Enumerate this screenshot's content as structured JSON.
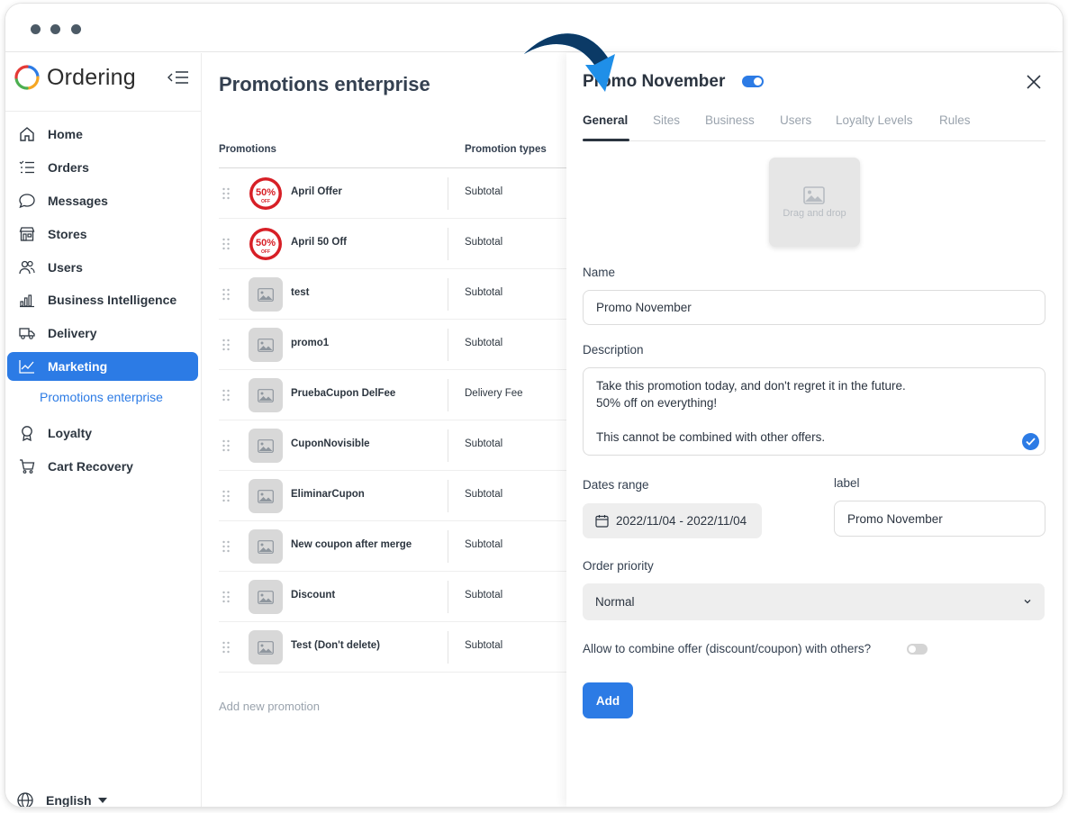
{
  "app": {
    "name": "Ordering",
    "brand_color": "#2c7be5"
  },
  "sidebar": {
    "items": [
      {
        "label": "Home",
        "icon": "home-icon"
      },
      {
        "label": "Orders",
        "icon": "list-icon"
      },
      {
        "label": "Messages",
        "icon": "chat-icon"
      },
      {
        "label": "Stores",
        "icon": "store-icon"
      },
      {
        "label": "Users",
        "icon": "users-icon"
      },
      {
        "label": "Business Intelligence",
        "icon": "bar-chart-icon"
      },
      {
        "label": "Delivery",
        "icon": "truck-icon"
      },
      {
        "label": "Marketing",
        "icon": "line-chart-icon",
        "active": true
      },
      {
        "label": "Loyalty",
        "icon": "award-icon"
      },
      {
        "label": "Cart Recovery",
        "icon": "cart-icon"
      }
    ],
    "sub_item": "Promotions enterprise",
    "language": "English"
  },
  "main": {
    "title": "Promotions enterprise",
    "columns": [
      "Promotions",
      "Promotion types"
    ],
    "rows": [
      {
        "name": "April Offer",
        "type": "Subtotal",
        "image": "50-off-badge"
      },
      {
        "name": "April 50 Off",
        "type": "Subtotal",
        "image": "50-off-badge"
      },
      {
        "name": "test",
        "type": "Subtotal",
        "image": "placeholder"
      },
      {
        "name": "promo1",
        "type": "Subtotal",
        "image": "placeholder"
      },
      {
        "name": "PruebaCupon DelFee",
        "type": "Delivery Fee",
        "image": "placeholder"
      },
      {
        "name": "CuponNovisible",
        "type": "Subtotal",
        "image": "placeholder"
      },
      {
        "name": "EliminarCupon",
        "type": "Subtotal",
        "image": "placeholder"
      },
      {
        "name": "New coupon after merge",
        "type": "Subtotal",
        "image": "placeholder"
      },
      {
        "name": "Discount",
        "type": "Subtotal",
        "image": "placeholder"
      },
      {
        "name": "Test (Don't delete)",
        "type": "Subtotal",
        "image": "placeholder"
      }
    ],
    "badge_text": "50%",
    "badge_sub": "OFF",
    "add_new": "Add new promotion"
  },
  "panel": {
    "title": "Promo November",
    "enabled": true,
    "tabs": [
      "General",
      "Sites",
      "Business",
      "Users",
      "Loyalty Levels",
      "Rules"
    ],
    "active_tab": "General",
    "dropzone_text": "Drag and drop",
    "name_label": "Name",
    "name_value": "Promo November",
    "description_label": "Description",
    "description_lines": [
      "Take this promotion today, and don't regret it in the future.",
      "50% off on everything!",
      "",
      "This cannot be combined with other offers."
    ],
    "dates_label": "Dates range",
    "dates_value": "2022/11/04 - 2022/11/04",
    "label_label": "label",
    "label_value": "Promo November",
    "priority_label": "Order priority",
    "priority_value": "Normal",
    "combine_label": "Allow to combine offer (discount/coupon) with others?",
    "combine_enabled": false,
    "add_button": "Add"
  }
}
